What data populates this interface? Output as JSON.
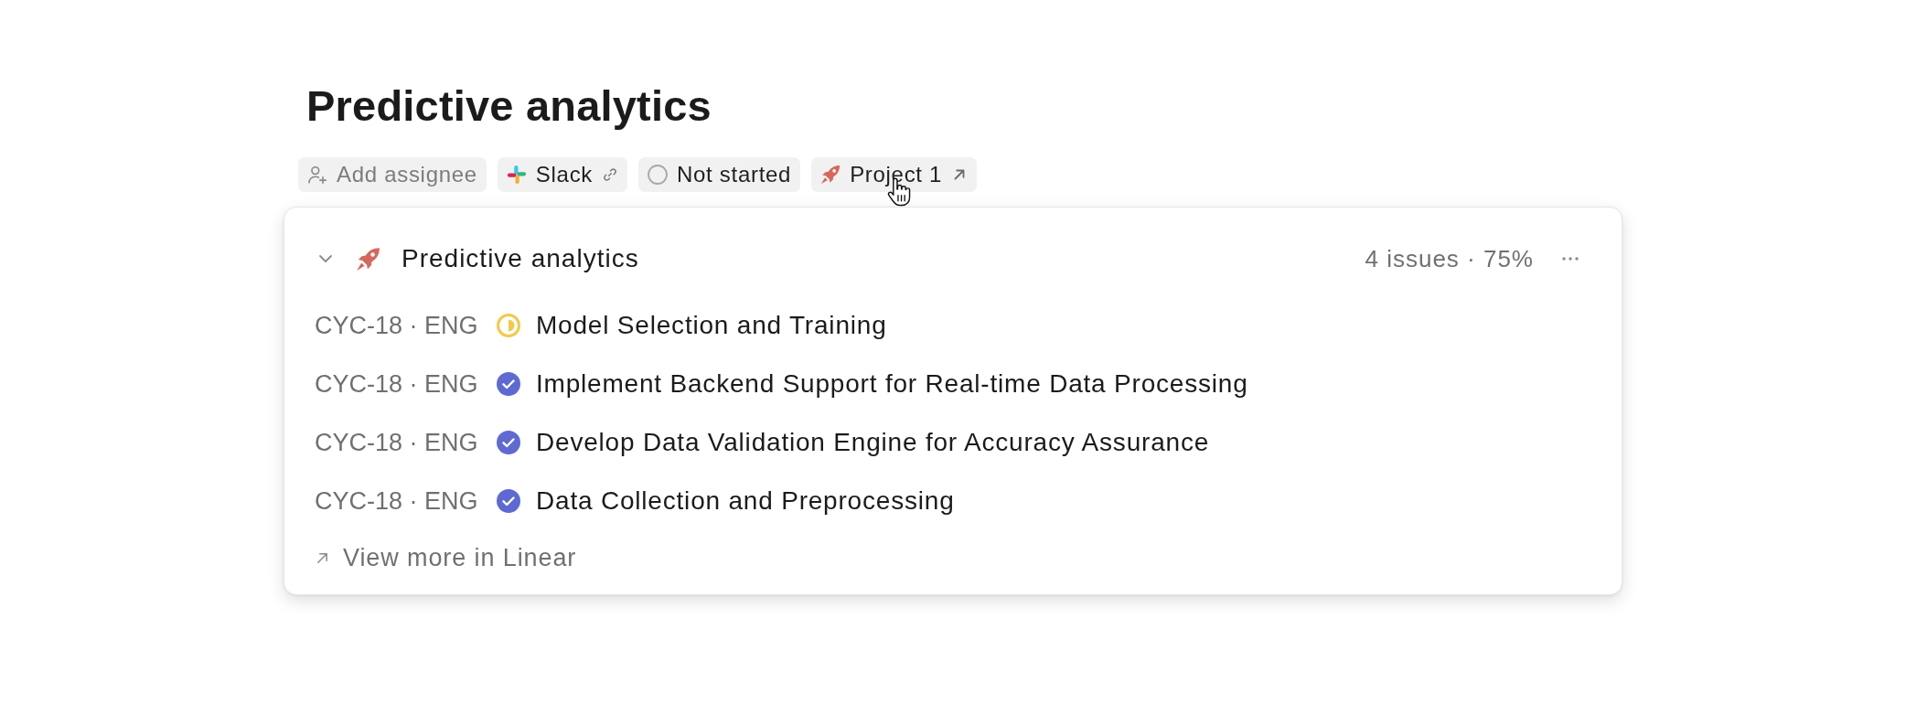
{
  "page": {
    "title": "Predictive analytics"
  },
  "properties": [
    {
      "kind": "assignee",
      "label": "Add assignee"
    },
    {
      "kind": "integration",
      "label": "Slack"
    },
    {
      "kind": "status",
      "label": "Not started"
    },
    {
      "kind": "project",
      "label": "Project 1"
    }
  ],
  "project_card": {
    "expanded": true,
    "title": "Predictive analytics",
    "summary": "4 issues · 75%",
    "issues": [
      {
        "id": "CYC-18 · ENG",
        "kind": "started",
        "title": "Model Selection and Training"
      },
      {
        "id": "CYC-18 · ENG",
        "kind": "done",
        "title": "Implement Backend Support for Real-time Data Processing"
      },
      {
        "id": "CYC-18 · ENG",
        "kind": "done",
        "title": "Develop Data Validation Engine for Accuracy Assurance"
      },
      {
        "id": "CYC-18 · ENG",
        "kind": "done",
        "title": "Data Collection and Preprocessing"
      }
    ],
    "footer_link": "View more in Linear"
  }
}
